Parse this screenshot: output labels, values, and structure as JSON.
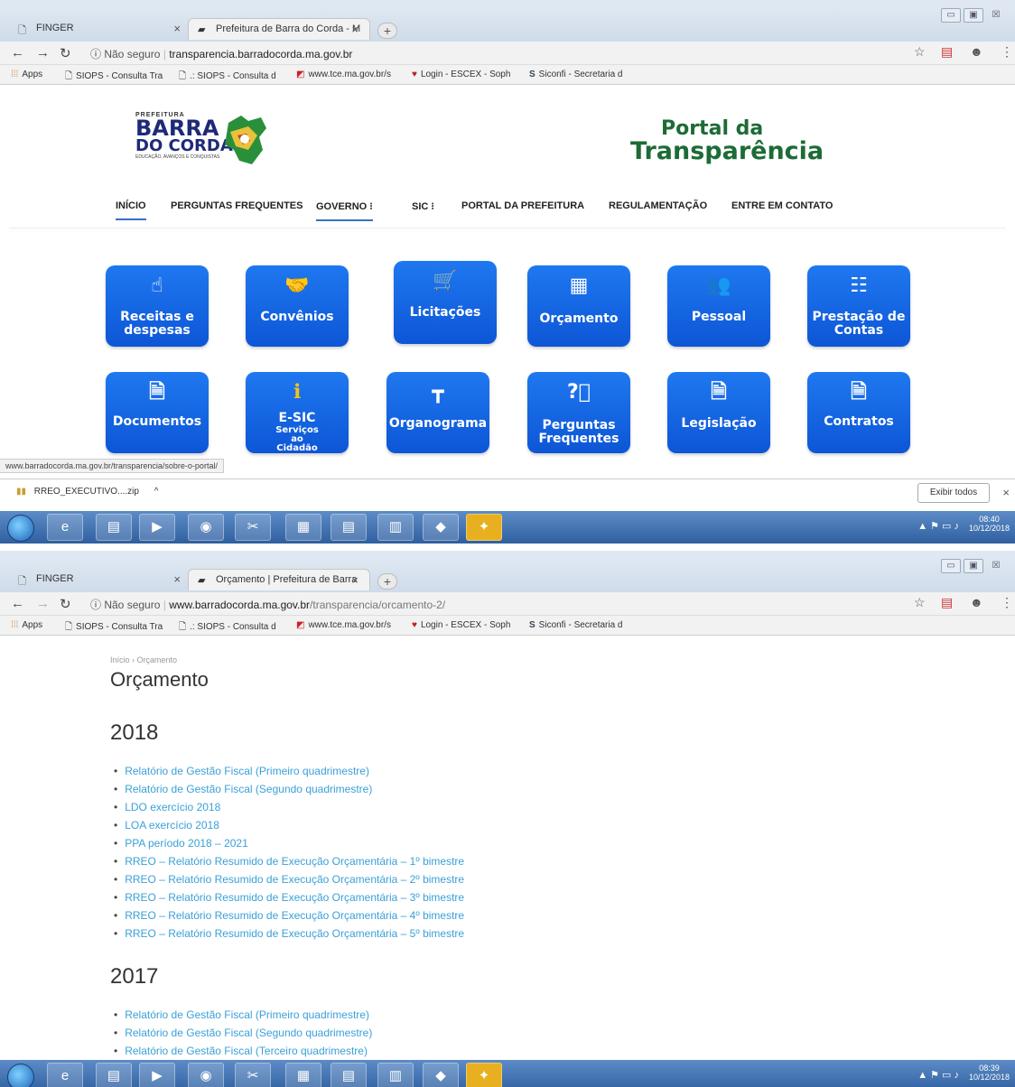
{
  "shot1": {
    "tabs": [
      {
        "label": "FINGER"
      },
      {
        "label": "Prefeitura de Barra do Corda - M"
      }
    ],
    "address": {
      "security": "Não seguro",
      "domain": "transparencia.barradocorda.ma.gov.br",
      "path": ""
    },
    "bookmarks": [
      "Apps",
      "SIOPS - Consulta Tra",
      ".: SIOPS - Consulta d",
      "www.tce.ma.gov.br/s",
      "Login - ESCEX - Soph",
      "Siconfi - Secretaria d"
    ],
    "logo": {
      "top": "PREFEITURA",
      "line1": "BARRA",
      "line2": "DO CORDA",
      "sub": "EDUCAÇÃO, AVANÇOS E CONQUISTAS"
    },
    "portal_title": {
      "l1": "Portal da",
      "l2": "Transparência"
    },
    "nav": [
      "INÍCIO",
      "PERGUNTAS FREQUENTES",
      "GOVERNO ⁝",
      "SIC ⁝",
      "PORTAL DA PREFEITURA",
      "REGULAMENTAÇÃO",
      "ENTRE EM CONTATO"
    ],
    "tiles_row1": [
      {
        "label": "Receitas e despesas",
        "icon": "hand-coins-icon"
      },
      {
        "label": "Convênios",
        "icon": "handshake-icon"
      },
      {
        "label": "Licitações",
        "icon": "cart-icon"
      },
      {
        "label": "Orçamento",
        "icon": "calculator-icon"
      },
      {
        "label": "Pessoal",
        "icon": "people-icon"
      },
      {
        "label": "Prestação de Contas",
        "icon": "checklist-icon"
      }
    ],
    "tiles_row2": [
      {
        "label": "Documentos",
        "icon": "document-icon"
      },
      {
        "label": "E-SIC",
        "sub": "Serviços ao Cidadão",
        "icon": "info-icon"
      },
      {
        "label": "Organograma",
        "icon": "org-chart-icon"
      },
      {
        "label": "Perguntas Frequentes",
        "icon": "question-icon"
      },
      {
        "label": "Legislação",
        "icon": "document-icon"
      },
      {
        "label": "Contratos",
        "icon": "document-icon"
      }
    ],
    "status_url": "www.barradocorda.ma.gov.br/transparencia/sobre-o-portal/",
    "download": {
      "file": "RREO_EXECUTIVO....zip",
      "show_all": "Exibir todos"
    },
    "clock": {
      "time": "08:40",
      "date": "10/12/2018"
    }
  },
  "shot2": {
    "tabs": [
      {
        "label": "FINGER"
      },
      {
        "label": "Orçamento | Prefeitura de Barra"
      }
    ],
    "address": {
      "security": "Não seguro",
      "domain": "www.barradocorda.ma.gov.br",
      "path": "/transparencia/orcamento-2/"
    },
    "breadcrumb": "Início  ›  Orçamento",
    "page_title": "Orçamento",
    "sections": [
      {
        "year": "2018",
        "items": [
          "Relatório de Gestão Fiscal (Primeiro quadrimestre)",
          "Relatório de Gestão Fiscal (Segundo quadrimestre)",
          "LDO exercício 2018",
          "LOA exercício 2018",
          "PPA período 2018 – 2021",
          "RREO – Relatório Resumido de Execução Orçamentária – 1º bimestre",
          "RREO – Relatório Resumido de Execução Orçamentária – 2º bimestre",
          "RREO – Relatório Resumido de Execução Orçamentária – 3º bimestre",
          "RREO – Relatório Resumido de Execução Orçamentária – 4º bimestre",
          "RREO – Relatório Resumido de Execução Orçamentária – 5º bimestre"
        ]
      },
      {
        "year": "2017",
        "items": [
          "Relatório de Gestão Fiscal (Primeiro quadrimestre)",
          "Relatório de Gestão Fiscal (Segundo quadrimestre)",
          "Relatório de Gestão Fiscal (Terceiro quadrimestre)"
        ]
      }
    ],
    "clock": {
      "time": "08:39",
      "date": "10/12/2018"
    }
  },
  "colors": {
    "tile_blue": "#0d56d6",
    "link_blue": "#3aa0d8",
    "portal_green": "#1d6b36",
    "nav_underline": "#3a6fc4"
  }
}
